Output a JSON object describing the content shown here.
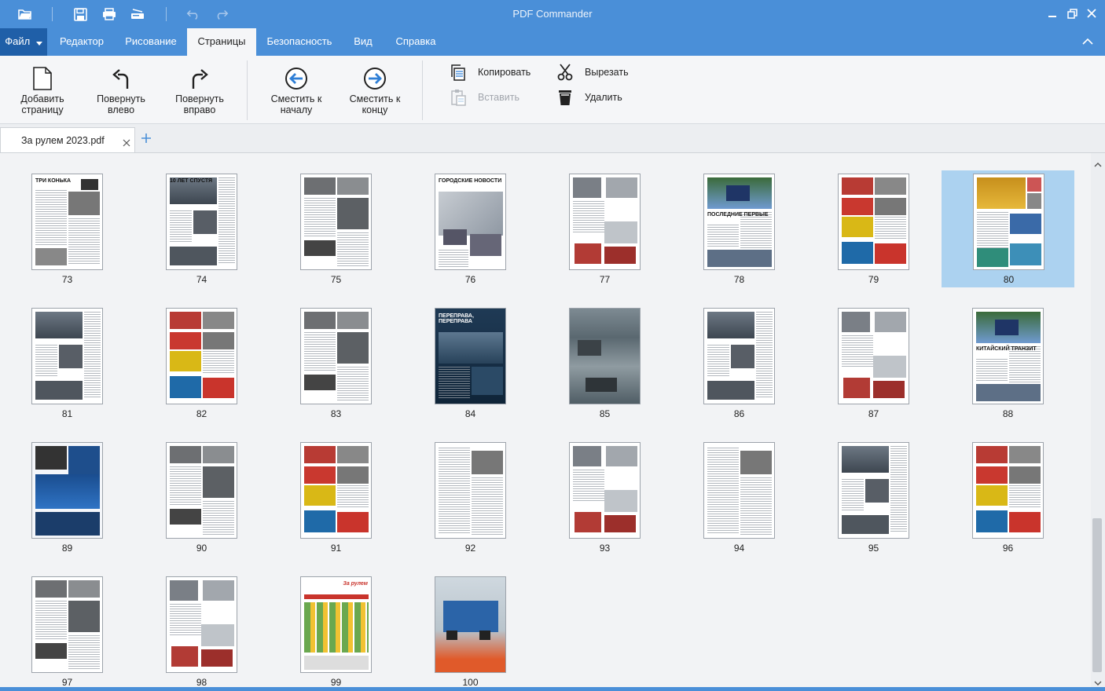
{
  "app": {
    "title": "PDF Commander"
  },
  "quick_access": [
    "open-folder-icon",
    "save-icon",
    "print-icon",
    "scan-icon",
    "undo-icon",
    "redo-icon"
  ],
  "menu": {
    "file": "Файл",
    "tabs": [
      "Редактор",
      "Рисование",
      "Страницы",
      "Безопасность",
      "Вид",
      "Справка"
    ],
    "active_tab": "Страницы"
  },
  "ribbon": {
    "add_page": [
      "Добавить",
      "страницу"
    ],
    "rotate_left": [
      "Повернуть",
      "влево"
    ],
    "rotate_right": [
      "Повернуть",
      "вправо"
    ],
    "move_start": [
      "Сместить к",
      "началу"
    ],
    "move_end": [
      "Сместить к",
      "концу"
    ],
    "copy": "Копировать",
    "paste": "Вставить",
    "cut": "Вырезать",
    "delete": "Удалить"
  },
  "document_tab": {
    "label": "За рулем 2023.pdf"
  },
  "colors": {
    "accent": "#4a8fd8",
    "file_tab": "#1f5fa8",
    "selection": "#acd2f0"
  },
  "selected_page": "80",
  "pages": [
    {
      "num": "73",
      "title": "ТРИ КОНЬКА",
      "style": "a"
    },
    {
      "num": "74",
      "title": "10 ЛЕТ СПУСТЯ",
      "style": "b"
    },
    {
      "num": "75",
      "title": "",
      "style": "c"
    },
    {
      "num": "76",
      "title": "ГОРОДСКИЕ НОВОСТИ",
      "style": "d"
    },
    {
      "num": "77",
      "title": "",
      "style": "e"
    },
    {
      "num": "78",
      "title": "ПОСЛЕДНИЕ ПЕРВЫЕ",
      "style": "f"
    },
    {
      "num": "79",
      "title": "",
      "style": "g"
    },
    {
      "num": "80",
      "title": "",
      "style": "h"
    },
    {
      "num": "81",
      "title": "",
      "style": "b"
    },
    {
      "num": "82",
      "title": "",
      "style": "g"
    },
    {
      "num": "83",
      "title": "",
      "style": "c"
    },
    {
      "num": "84",
      "title": "ПЕРЕПРАВА, ПЕРЕПРАВА",
      "style": "dark"
    },
    {
      "num": "85",
      "title": "",
      "style": "photo"
    },
    {
      "num": "86",
      "title": "",
      "style": "b"
    },
    {
      "num": "87",
      "title": "",
      "style": "e"
    },
    {
      "num": "88",
      "title": "КИТАЙСКИЙ ТРАНЗИТ",
      "style": "f"
    },
    {
      "num": "89",
      "title": "",
      "style": "ad"
    },
    {
      "num": "90",
      "title": "",
      "style": "c"
    },
    {
      "num": "91",
      "title": "",
      "style": "g"
    },
    {
      "num": "92",
      "title": "",
      "style": "text"
    },
    {
      "num": "93",
      "title": "",
      "style": "e"
    },
    {
      "num": "94",
      "title": "",
      "style": "text"
    },
    {
      "num": "95",
      "title": "",
      "style": "b"
    },
    {
      "num": "96",
      "title": "",
      "style": "g"
    },
    {
      "num": "97",
      "title": "",
      "style": "c"
    },
    {
      "num": "98",
      "title": "",
      "style": "e"
    },
    {
      "num": "99",
      "title": "За рулем",
      "style": "catalog"
    },
    {
      "num": "100",
      "title": "",
      "style": "truck"
    }
  ]
}
